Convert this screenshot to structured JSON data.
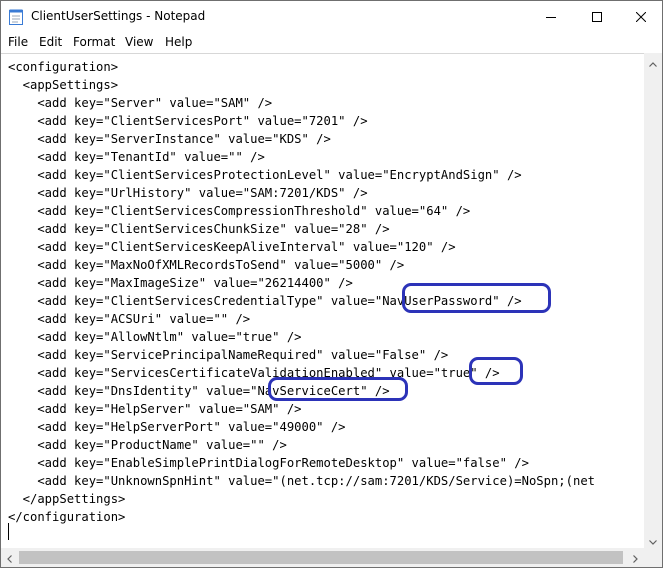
{
  "window": {
    "title": "ClientUserSettings - Notepad"
  },
  "menu": [
    {
      "label": "File"
    },
    {
      "label": "Edit"
    },
    {
      "label": "Format"
    },
    {
      "label": "View"
    },
    {
      "label": "Help"
    }
  ],
  "document": {
    "lines": [
      "<configuration>",
      "  <appSettings>",
      "    <add key=\"Server\" value=\"SAM\" />",
      "    <add key=\"ClientServicesPort\" value=\"7201\" />",
      "    <add key=\"ServerInstance\" value=\"KDS\" />",
      "    <add key=\"TenantId\" value=\"\" />",
      "    <add key=\"ClientServicesProtectionLevel\" value=\"EncryptAndSign\" />",
      "    <add key=\"UrlHistory\" value=\"SAM:7201/KDS\" />",
      "    <add key=\"ClientServicesCompressionThreshold\" value=\"64\" />",
      "    <add key=\"ClientServicesChunkSize\" value=\"28\" />",
      "    <add key=\"ClientServicesKeepAliveInterval\" value=\"120\" />",
      "    <add key=\"MaxNoOfXMLRecordsToSend\" value=\"5000\" />",
      "    <add key=\"MaxImageSize\" value=\"26214400\" />",
      "    <add key=\"ClientServicesCredentialType\" value=\"NavUserPassword\" />",
      "    <add key=\"ACSUri\" value=\"\" />",
      "    <add key=\"AllowNtlm\" value=\"true\" />",
      "    <add key=\"ServicePrincipalNameRequired\" value=\"False\" />",
      "    <add key=\"ServicesCertificateValidationEnabled\" value=\"true\" />",
      "    <add key=\"DnsIdentity\" value=\"NavServiceCert\" />",
      "    <add key=\"HelpServer\" value=\"SAM\" />",
      "    <add key=\"HelpServerPort\" value=\"49000\" />",
      "    <add key=\"ProductName\" value=\"\" />",
      "    <add key=\"EnableSimplePrintDialogForRemoteDesktop\" value=\"false\" />",
      "    <add key=\"UnknownSpnHint\" value=\"(net.tcp://sam:7201/KDS/Service)=NoSpn;(net",
      "  </appSettings>",
      "</configuration>"
    ]
  },
  "annotations": {
    "color": "#2c33b8"
  },
  "icons": {
    "app": "notepad-icon",
    "minimize": "minimize-icon",
    "maximize": "maximize-icon",
    "close": "close-icon"
  }
}
